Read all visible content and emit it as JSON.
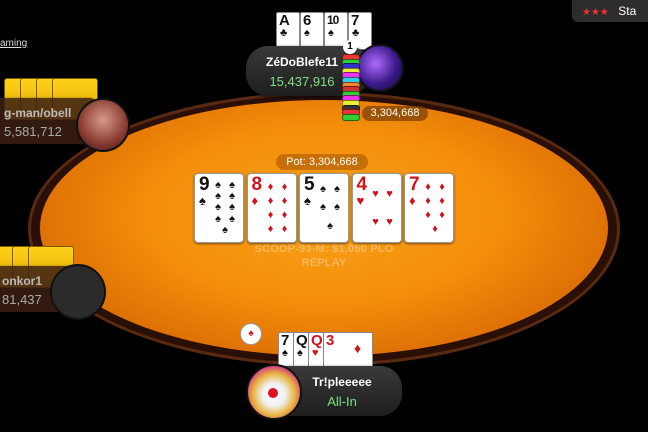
{
  "top_left_text": "aming",
  "top_right": {
    "stars": "★★★",
    "text": "Sta"
  },
  "table": {
    "watermark_line1": "SCOOP-93-M: $1,050 PLO",
    "watermark_line2": "REPLAY"
  },
  "pot": {
    "label": "Pot: 3,304,668"
  },
  "bet": {
    "amount": "3,304,668",
    "dealer_symbol": "♠"
  },
  "board": [
    {
      "rank": "9",
      "suit": "♠",
      "color": "black"
    },
    {
      "rank": "8",
      "suit": "♦",
      "color": "red"
    },
    {
      "rank": "5",
      "suit": "♠",
      "color": "black"
    },
    {
      "rank": "4",
      "suit": "♥",
      "color": "red"
    },
    {
      "rank": "7",
      "suit": "♦",
      "color": "red"
    }
  ],
  "players": {
    "top": {
      "name": "ZéDoBlefe11",
      "stack": "15,437,916",
      "cards": [
        {
          "rank": "A",
          "suit": "♣"
        },
        {
          "rank": "6",
          "suit": "♠"
        },
        {
          "rank": "10",
          "suit": "♠"
        },
        {
          "rank": "7",
          "suit": "♣"
        }
      ],
      "badge": "1"
    },
    "left_upper": {
      "name": "g-man/obell",
      "stack": "5,581,712"
    },
    "left_lower": {
      "name": "onkor1",
      "stack": "81,437"
    },
    "bottom": {
      "name": "Tr!pleeeee",
      "status": "All-In",
      "cards": [
        {
          "rank": "7",
          "suit": "♠",
          "color": "black"
        },
        {
          "rank": "Q",
          "suit": "♠",
          "color": "black"
        },
        {
          "rank": "Q",
          "suit": "♥",
          "color": "red"
        },
        {
          "rank": "3",
          "suit": "♦",
          "color": "red"
        }
      ]
    }
  },
  "colors": {
    "felt": "#f38d0a",
    "stack_green": "#7fe07f"
  }
}
